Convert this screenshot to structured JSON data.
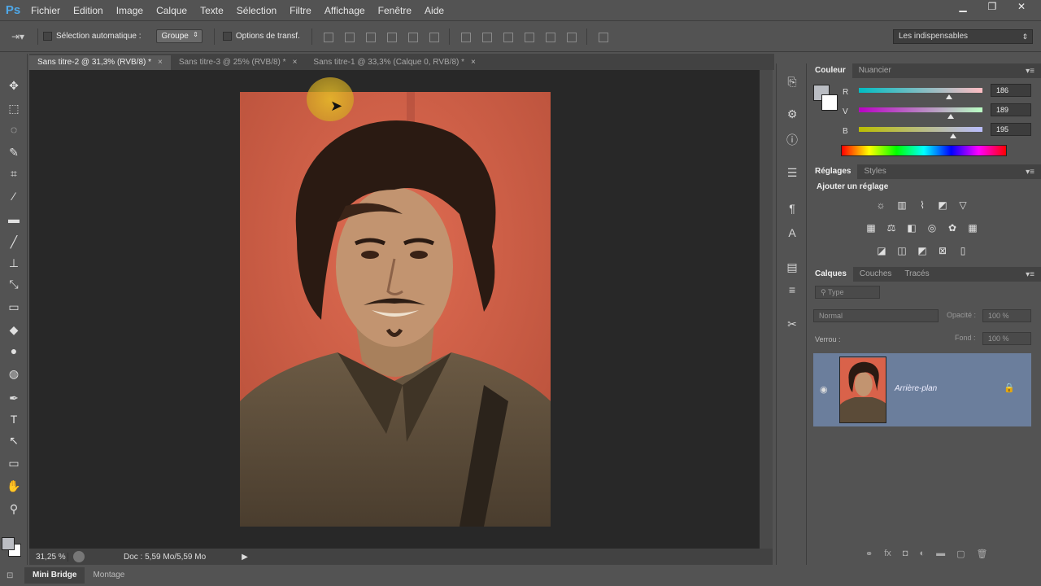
{
  "app": {
    "logo": "Ps"
  },
  "menu": [
    "Fichier",
    "Edition",
    "Image",
    "Calque",
    "Texte",
    "Sélection",
    "Filtre",
    "Affichage",
    "Fenêtre",
    "Aide"
  ],
  "window_controls": {
    "minimize": "▁",
    "restore": "❐",
    "close": "✕"
  },
  "options": {
    "auto_select_label": "Sélection automatique :",
    "auto_select_value": "Groupe",
    "transform_label": "Options de transf.",
    "workspace": "Les indispensables"
  },
  "doc_tabs": [
    {
      "label": "Sans titre-2 @ 31,3% (RVB/8) *",
      "close": "×"
    },
    {
      "label": "Sans titre-3 @ 25% (RVB/8) *",
      "close": "×"
    },
    {
      "label": "Sans titre-1 @ 33,3% (Calque 0, RVB/8) *",
      "close": "×"
    }
  ],
  "status": {
    "zoom": "31,25 %",
    "doc": "Doc : 5,59 Mo/5,59 Mo"
  },
  "bottom_tabs": [
    "Mini Bridge",
    "Montage"
  ],
  "color_panel": {
    "tabs": [
      "Couleur",
      "Nuancier"
    ],
    "sliders": [
      {
        "label": "R",
        "value": "186",
        "level": 186
      },
      {
        "label": "V",
        "value": "189",
        "level": 189
      },
      {
        "label": "B",
        "value": "195",
        "level": 195
      }
    ],
    "foreground": "#babdc3"
  },
  "adjust_panel": {
    "tabs": [
      "Réglages",
      "Styles"
    ],
    "heading": "Ajouter un réglage"
  },
  "layers_panel": {
    "tabs": [
      "Calques",
      "Couches",
      "Tracés"
    ],
    "filter_type": "Type",
    "blend_mode": "Normal",
    "opacity_label": "Opacité :",
    "opacity_value": "100 %",
    "lock_label": "Verrou :",
    "fill_label": "Fond :",
    "fill_value": "100 %",
    "layer_name": "Arrière-plan"
  },
  "colors": {
    "selected_layer": "#6b7e9c",
    "canvas_bg": "#282828",
    "photo_bg": "#d9624a"
  }
}
